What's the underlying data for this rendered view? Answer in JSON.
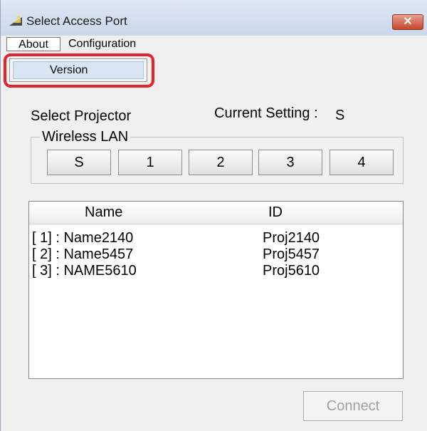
{
  "window": {
    "title": "Select Access Port",
    "close_label": "✕",
    "icon": "app-icon"
  },
  "menu": {
    "items": [
      {
        "label": "About"
      },
      {
        "label": "Configuration"
      }
    ],
    "dropdown_items": [
      {
        "label": "Version"
      }
    ]
  },
  "projector": {
    "select_label": "Select Projector",
    "current_setting_label": "Current Setting :",
    "current_setting_value": "S",
    "group_label": "Wireless LAN",
    "buttons": [
      {
        "label": "S"
      },
      {
        "label": "1"
      },
      {
        "label": "2"
      },
      {
        "label": "3"
      },
      {
        "label": "4"
      }
    ]
  },
  "list": {
    "columns": [
      "Name",
      "ID"
    ],
    "rows": [
      {
        "name": "[ 1] : Name2140",
        "id": "Proj2140"
      },
      {
        "name": "[ 2] : Name5457",
        "id": "Proj5457"
      },
      {
        "name": "[ 3] : NAME5610",
        "id": "Proj5610"
      }
    ]
  },
  "connect_label": "Connect",
  "colors": {
    "highlight": "#e3242b",
    "close": "#c8452c",
    "selection": "#d8e6f4"
  }
}
